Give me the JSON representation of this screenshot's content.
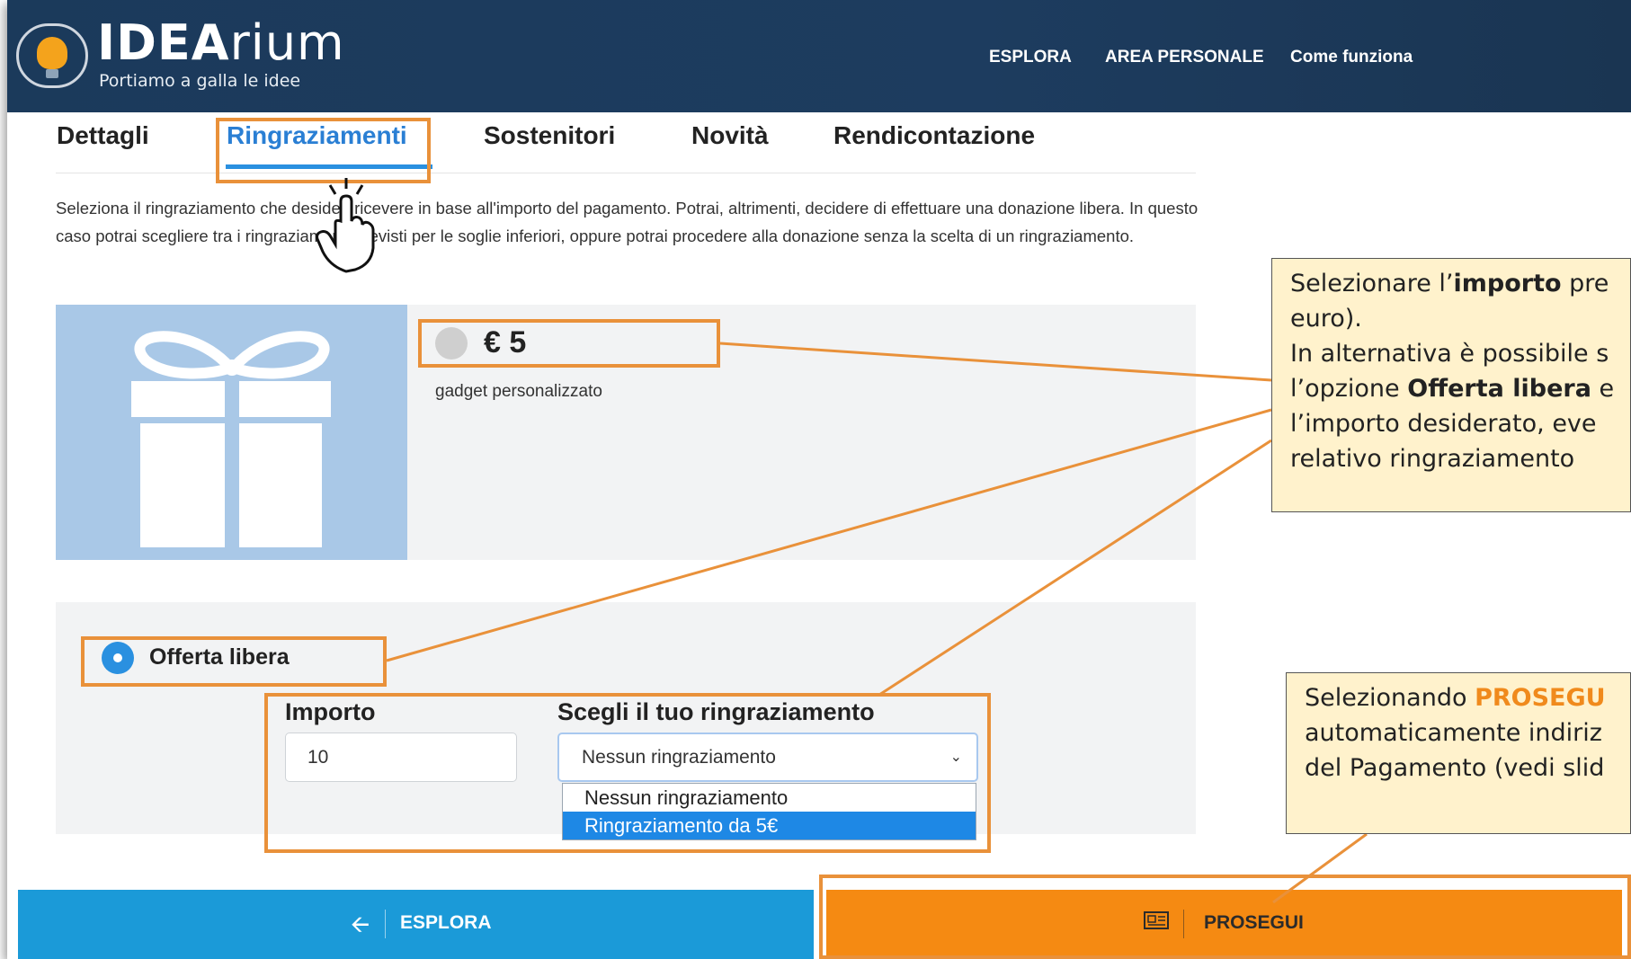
{
  "header": {
    "logo_bold": "IDEA",
    "logo_rest": "rium",
    "tagline": "Portiamo a galla le idee",
    "nav": [
      "ESPLORA",
      "AREA PERSONALE",
      "Come funziona"
    ]
  },
  "tabs": [
    "Dettagli",
    "Ringraziamenti",
    "Sostenitori",
    "Novità",
    "Rendicontazione"
  ],
  "active_tab": "Ringraziamenti",
  "description": "Seleziona il ringraziamento che desideri ricevere in base all'importo del pagamento. Potrai, altrimenti, decidere di effettuare una donazione libera. In questo caso potrai scegliere tra i ringraziamenti previsti per le soglie inferiori, oppure potrai procedere alla donazione senza la scelta di un ringraziamento.",
  "reward": {
    "amount": "€ 5",
    "description": "gadget personalizzato",
    "selected": false
  },
  "free_offer": {
    "label": "Offerta libera",
    "selected": true,
    "amount_label": "Importo",
    "amount_value": "10",
    "reward_label": "Scegli il tuo ringraziamento",
    "reward_selected": "Nessun ringraziamento",
    "reward_options": [
      "Nessun ringraziamento",
      "Ringraziamento da 5€"
    ],
    "highlighted_option": "Ringraziamento da 5€"
  },
  "buttons": {
    "back": "ESPLORA",
    "next": "PROSEGUI"
  },
  "callouts": {
    "first": {
      "pre": "Selezionare l’",
      "bold1": "importo",
      "mid1": " pre",
      "line2": "euro).",
      "line3": "In alternativa è possibile s",
      "line4_pre": "l’opzione ",
      "bold2": "Offerta libera",
      "line4_post": " e",
      "line5": "l’importo desiderato, eve",
      "line6": "relativo ringraziamento"
    },
    "second": {
      "pre": "Selezionando ",
      "highlight": "PROSEGU",
      "line2": "automaticamente indiriz",
      "line3": "del Pagamento (vedi slid"
    }
  },
  "colors": {
    "header_bg": "#1b3a5b",
    "tab_active": "#2a7fd4",
    "back_button": "#1b9ad8",
    "next_button": "#f58a12",
    "annotation": "#e9913a",
    "callout_bg": "#fff2cc",
    "reward_image_bg": "#a9c8e7"
  },
  "icons": {
    "logo": "lightbulb-icon",
    "back": "arrow-left-icon",
    "next": "newspaper-icon",
    "select": "chevron-down-icon",
    "gift": "gift-icon",
    "cursor": "hand-pointer-icon"
  }
}
